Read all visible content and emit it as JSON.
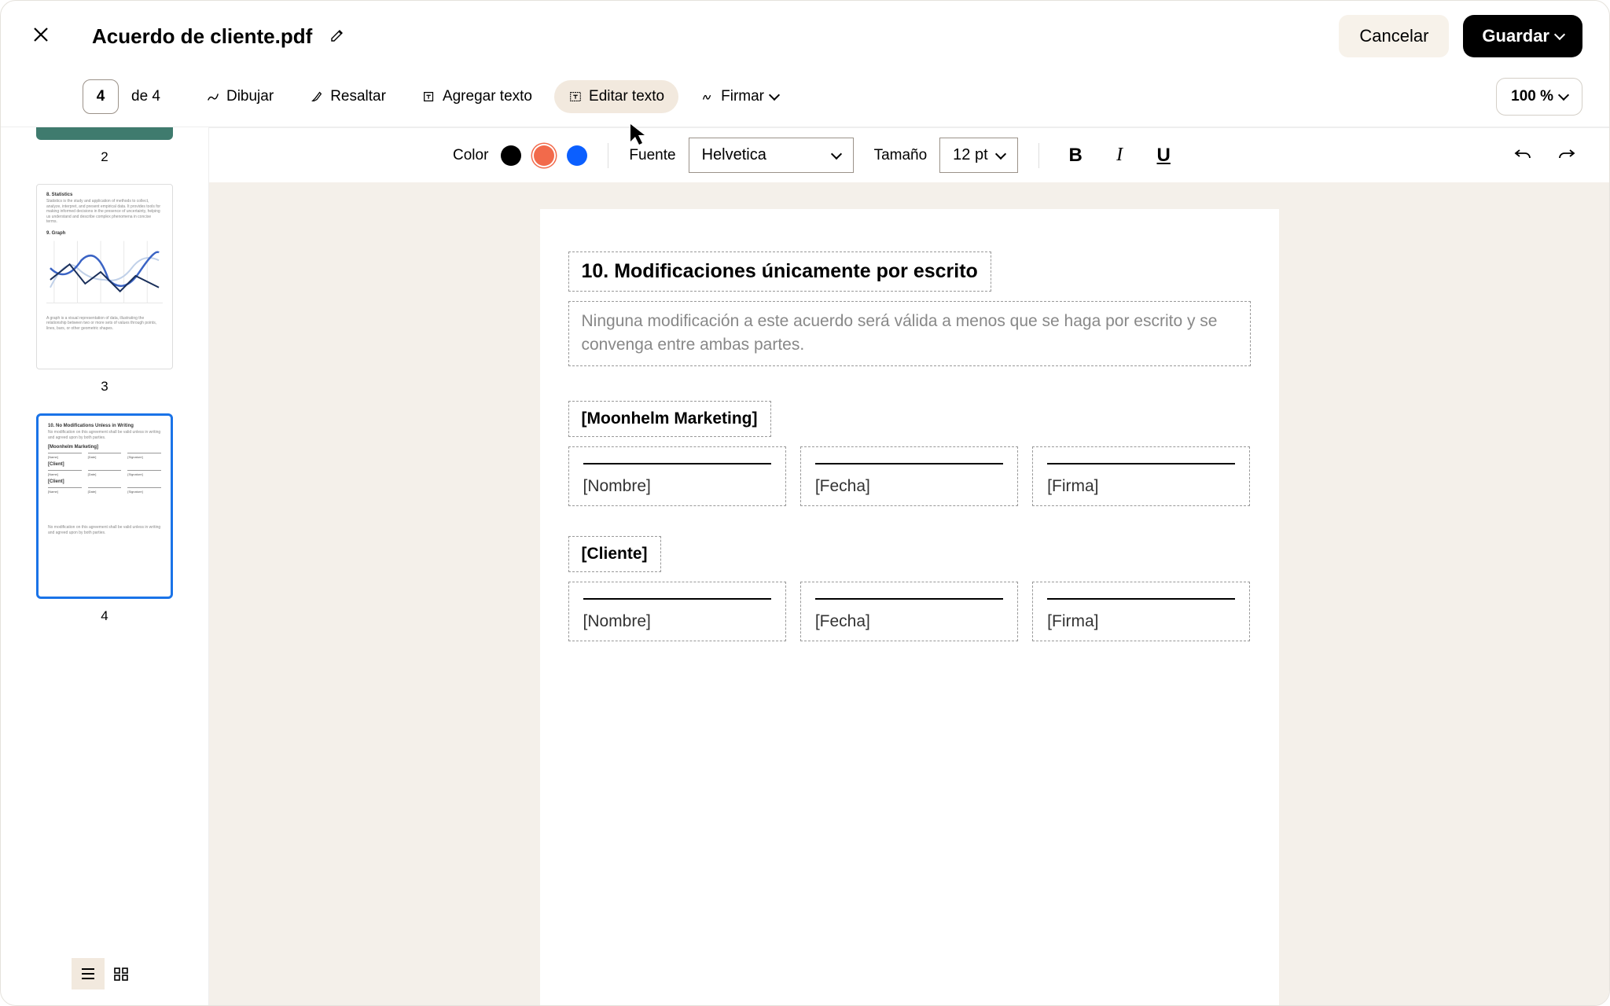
{
  "header": {
    "file_name": "Acuerdo de cliente.pdf",
    "cancel_label": "Cancelar",
    "save_label": "Guardar"
  },
  "toolbar": {
    "current_page": "4",
    "total_pages": "de 4",
    "tools": {
      "draw": "Dibujar",
      "highlight": "Resaltar",
      "add_text": "Agregar texto",
      "edit_text": "Editar texto",
      "sign": "Firmar"
    },
    "zoom": "100 %"
  },
  "format": {
    "color_label": "Color",
    "font_label": "Fuente",
    "font_value": "Helvetica",
    "size_label": "Tamaño",
    "size_value": "12 pt",
    "colors": {
      "black": "#000000",
      "orange": "#f26a4b",
      "blue": "#0b5fff"
    }
  },
  "thumbnails": {
    "page2_label": "2",
    "page3_label": "3",
    "page4_label": "4",
    "page3": {
      "title1": "8. Statistics",
      "body1": "Statistics is the study and application of methods to collect, analyze, interpret, and present empirical data. It provides tools for making informed decisions in the presence of uncertainty, helping us understand and describe complex phenomena in concise terms.",
      "title2": "9. Graph",
      "body2": "A graph is a visual representation of data, illustrating the relationship between two or more sets of values through points, lines, bars, or other geometric shapes."
    },
    "page4": {
      "title": "10. No Modifications Unless in Writing",
      "body": "No modification on this agreement shall be valid unless in writing and agreed upon by both parties.",
      "party1": "[Moonhelm Marketing]",
      "party2": "[Client]",
      "name": "[Name]",
      "date": "[Date]",
      "signature": "[Signature]"
    }
  },
  "document": {
    "heading": "10. Modificaciones únicamente por escrito",
    "body": "Ninguna modificación a este acuerdo será válida a menos que se haga por escrito y se convenga entre ambas partes.",
    "party1": "[Moonhelm Marketing]",
    "party2": "[Cliente]",
    "sig_name": "[Nombre]",
    "sig_date": "[Fecha]",
    "sig_signature": "[Firma]"
  }
}
